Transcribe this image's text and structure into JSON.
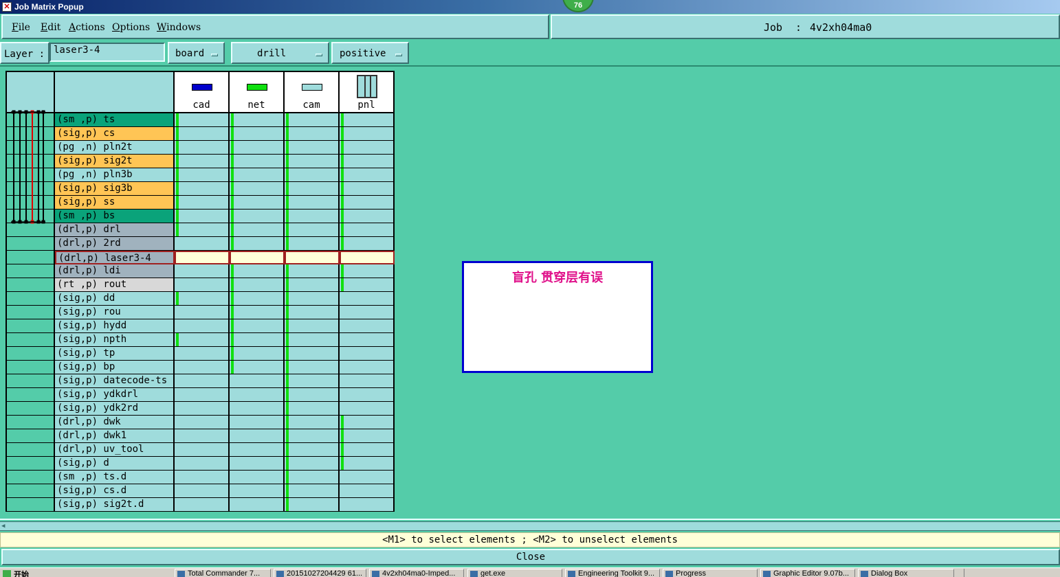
{
  "window": {
    "title": "Job Matrix Popup",
    "badge": "76",
    "close_icon": "x-icon"
  },
  "menu": {
    "items": [
      "File",
      "Edit",
      "Actions",
      "Options",
      "Windows"
    ]
  },
  "job": {
    "label": "Job",
    "separator": ":",
    "name": "4v2xh04ma0"
  },
  "layer_bar": {
    "label": "Layer :",
    "value": "laser3-4",
    "context": "board",
    "type": "drill",
    "polarity": "positive"
  },
  "matrix": {
    "columns": [
      {
        "name": "cad",
        "color": "#0000cc"
      },
      {
        "name": "net",
        "color": "#10e010"
      },
      {
        "name": "cam",
        "color": "#9fdcdc"
      },
      {
        "name": "pnl",
        "color": "#9fdcdc"
      }
    ],
    "selected_row": 10,
    "rows": [
      {
        "label": "(sm ,p) ts",
        "bg": "#0aa37a",
        "cells": [
          1,
          1,
          1,
          1
        ]
      },
      {
        "label": "(sig,p) cs",
        "bg": "#ffc555",
        "cells": [
          1,
          1,
          1,
          1
        ]
      },
      {
        "label": "(pg ,n) pln2t",
        "bg": "#9fdcdc",
        "cells": [
          1,
          1,
          1,
          1
        ]
      },
      {
        "label": "(sig,p) sig2t",
        "bg": "#ffc555",
        "cells": [
          1,
          1,
          1,
          1
        ]
      },
      {
        "label": "(pg ,n) pln3b",
        "bg": "#9fdcdc",
        "cells": [
          1,
          1,
          1,
          1
        ]
      },
      {
        "label": "(sig,p) sig3b",
        "bg": "#ffc555",
        "cells": [
          1,
          1,
          1,
          1
        ]
      },
      {
        "label": "(sig,p) ss",
        "bg": "#ffc555",
        "cells": [
          1,
          1,
          1,
          1
        ]
      },
      {
        "label": "(sm ,p) bs",
        "bg": "#0aa37a",
        "cells": [
          1,
          1,
          1,
          1
        ]
      },
      {
        "label": "(drl,p) drl",
        "bg": "#a0b2be",
        "cells": [
          1,
          1,
          1,
          1
        ]
      },
      {
        "label": "(drl,p) 2rd",
        "bg": "#a0b2be",
        "cells": [
          0,
          1,
          1,
          1
        ]
      },
      {
        "label": "(drl,p) laser3-4",
        "bg": "#a0b2be",
        "cells": [
          0,
          0,
          0,
          0
        ]
      },
      {
        "label": "(drl,p) ldi",
        "bg": "#a0b2be",
        "cells": [
          0,
          1,
          1,
          1
        ]
      },
      {
        "label": "(rt ,p) rout",
        "bg": "#d8d8d8",
        "cells": [
          0,
          1,
          1,
          1
        ]
      },
      {
        "label": "(sig,p) dd",
        "bg": "#9fdcdc",
        "cells": [
          1,
          1,
          1,
          0
        ]
      },
      {
        "label": "(sig,p) rou",
        "bg": "#9fdcdc",
        "cells": [
          0,
          1,
          1,
          0
        ]
      },
      {
        "label": "(sig,p) hydd",
        "bg": "#9fdcdc",
        "cells": [
          0,
          1,
          1,
          0
        ]
      },
      {
        "label": "(sig,p) npth",
        "bg": "#9fdcdc",
        "cells": [
          1,
          1,
          1,
          0
        ]
      },
      {
        "label": "(sig,p) tp",
        "bg": "#9fdcdc",
        "cells": [
          0,
          1,
          1,
          0
        ]
      },
      {
        "label": "(sig,p) bp",
        "bg": "#9fdcdc",
        "cells": [
          0,
          1,
          1,
          0
        ]
      },
      {
        "label": "(sig,p) datecode-ts",
        "bg": "#9fdcdc",
        "cells": [
          0,
          0,
          1,
          0
        ]
      },
      {
        "label": "(sig,p) ydkdrl",
        "bg": "#9fdcdc",
        "cells": [
          0,
          0,
          1,
          0
        ]
      },
      {
        "label": "(sig,p) ydk2rd",
        "bg": "#9fdcdc",
        "cells": [
          0,
          0,
          1,
          0
        ]
      },
      {
        "label": "(drl,p) dwk",
        "bg": "#9fdcdc",
        "cells": [
          0,
          0,
          1,
          1
        ]
      },
      {
        "label": "(drl,p) dwk1",
        "bg": "#9fdcdc",
        "cells": [
          0,
          0,
          1,
          1
        ]
      },
      {
        "label": "(drl,p) uv_tool",
        "bg": "#9fdcdc",
        "cells": [
          0,
          0,
          1,
          1
        ]
      },
      {
        "label": "(sig,p) d",
        "bg": "#9fdcdc",
        "cells": [
          0,
          0,
          1,
          1
        ]
      },
      {
        "label": "(sm ,p) ts.d",
        "bg": "#9fdcdc",
        "cells": [
          0,
          0,
          1,
          0
        ]
      },
      {
        "label": "(sig,p) cs.d",
        "bg": "#9fdcdc",
        "cells": [
          0,
          0,
          1,
          0
        ]
      },
      {
        "label": "(sig,p) sig2t.d",
        "bg": "#9fdcdc",
        "cells": [
          0,
          0,
          1,
          0
        ]
      }
    ]
  },
  "message": {
    "text": "盲孔 贯穿层有误"
  },
  "hint": "<M1> to select elements ; <M2> to unselect elements",
  "close_label": "Close",
  "taskbar": {
    "start": "开始",
    "items": [
      "Total Commander 7...",
      "20151027204429 61...",
      "4v2xh04ma0-Imped...",
      "get.exe",
      "Engineering Toolkit 9...",
      "Progress",
      "Graphic Editor 9.07b...",
      "Dialog Box"
    ]
  }
}
